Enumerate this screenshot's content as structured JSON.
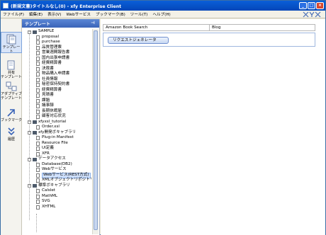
{
  "window": {
    "title": "(新規文書)タイトルなし(0) - xfy Enterprise Client"
  },
  "menu": [
    "ファイル(F)",
    "編集(E)",
    "表示(V)",
    "Webサービス",
    "ブックマーク(B)",
    "ツール(T)",
    "ヘルプ(H)"
  ],
  "sidebar": [
    {
      "label": "テンプレート",
      "icon": "template-icon"
    },
    {
      "label": "共有\nテンプレート",
      "icon": "shared-template-icon"
    },
    {
      "label": "アダプティブ\nテンプレート",
      "icon": "adaptive-template-icon"
    },
    {
      "label": "ブックマーク",
      "icon": "bookmark-arrow-icon"
    },
    {
      "label": "履歴",
      "icon": "history-icon"
    }
  ],
  "panel": {
    "title": "テンプレート"
  },
  "tree": {
    "groups": [
      {
        "label": "SAMPLE",
        "items": [
          "proposal",
          "purchase",
          "品質管理票",
          "営業週間報告書",
          "国内出張申請書",
          "経費精算書",
          "決裁書",
          "物品購入申請書",
          "社員情報",
          "秘密保持契約書",
          "経費精算書",
          "見積書",
          "課題",
          "議事録",
          "長期休暇届",
          "顧客対応状況"
        ]
      },
      {
        "label": "xfyxsl_tutorial",
        "items": [
          "Order.xsl"
        ]
      },
      {
        "label": "xfy開発ボキャブラリ",
        "items": [
          "Plug-in Manifest",
          "Resource File",
          "UI定義",
          "XFR"
        ]
      },
      {
        "label": "データアクセス",
        "items": [
          "Database(DB2)",
          "Webサービス",
          "Webサービス(REST方式)",
          "XMLオブジェクトリポジトリ"
        ]
      },
      {
        "label": "標準ボキャブラリ",
        "items": [
          "Calslet",
          "MathML",
          "SVG",
          "XHTML"
        ]
      }
    ],
    "selected": "Webサービス(REST方式)"
  },
  "main": {
    "tabs": [
      "Amazon Book Search",
      "Blog"
    ],
    "request_button": "リクエストジェネレータ"
  },
  "colors": {
    "title_bar": "#0a5fd8",
    "panel_header": "#3a64b8",
    "selected_bg": "#cfe0fb"
  }
}
